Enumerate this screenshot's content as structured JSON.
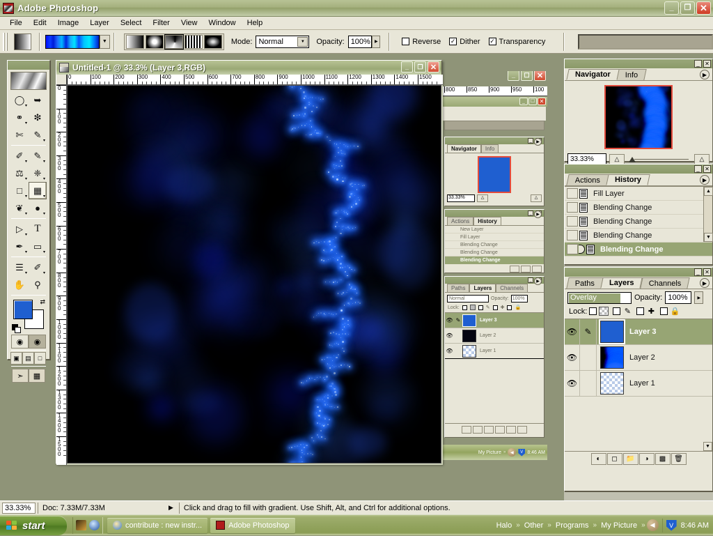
{
  "app": {
    "title": "Adobe Photoshop",
    "icon": "photoshop-icon",
    "window_buttons": {
      "minimize": "_",
      "maximize": "❐",
      "close": "✕"
    }
  },
  "menu": {
    "items": [
      "File",
      "Edit",
      "Image",
      "Layer",
      "Select",
      "Filter",
      "View",
      "Window",
      "Help"
    ]
  },
  "options_bar": {
    "tool": "gradient-tool",
    "gradient_preset": "blue-cyan-stripes",
    "gradient_types": [
      "linear-gradient",
      "radial-gradient",
      "angle-gradient",
      "reflected-gradient",
      "diamond-gradient"
    ],
    "gradient_type_selected_index": 2,
    "mode_label": "Mode:",
    "mode_value": "Normal",
    "opacity_label": "Opacity:",
    "opacity_value": "100%",
    "reverse_label": "Reverse",
    "reverse_checked": false,
    "dither_label": "Dither",
    "dither_checked": true,
    "transparency_label": "Transparency",
    "transparency_checked": true
  },
  "toolbox": {
    "tools": [
      {
        "name": "marquee-tool",
        "glyph": "◯"
      },
      {
        "name": "move-tool",
        "glyph": "✥"
      },
      {
        "name": "lasso-tool",
        "glyph": "☁"
      },
      {
        "name": "magic-wand-tool",
        "glyph": "✳"
      },
      {
        "name": "crop-tool",
        "glyph": "⛶"
      },
      {
        "name": "slice-tool",
        "glyph": "✐"
      },
      {
        "name": "healing-brush-tool",
        "glyph": "✎"
      },
      {
        "name": "brush-tool",
        "glyph": "✒"
      },
      {
        "name": "clone-stamp-tool",
        "glyph": "⚑"
      },
      {
        "name": "history-brush-tool",
        "glyph": "❄"
      },
      {
        "name": "eraser-tool",
        "glyph": "▱"
      },
      {
        "name": "gradient-tool",
        "glyph": "▨"
      },
      {
        "name": "blur-tool",
        "glyph": "❧"
      },
      {
        "name": "dodge-tool",
        "glyph": "⚫"
      },
      {
        "name": "path-selection-tool",
        "glyph": "↖"
      },
      {
        "name": "type-tool",
        "glyph": "T"
      },
      {
        "name": "pen-tool",
        "glyph": "✑"
      },
      {
        "name": "shape-tool",
        "glyph": "▭"
      },
      {
        "name": "notes-tool",
        "glyph": "◰"
      },
      {
        "name": "eyedropper-tool",
        "glyph": "⚗"
      },
      {
        "name": "hand-tool",
        "glyph": "✋"
      },
      {
        "name": "zoom-tool",
        "glyph": "⌕"
      }
    ],
    "selected_tool": "gradient-tool",
    "foreground_color": "#1f5fd0",
    "background_color": "#ffffff",
    "mask_modes": [
      "standard-mode",
      "quick-mask-mode"
    ],
    "screen_modes": [
      "standard-screen-mode",
      "full-screen-with-menubar",
      "full-screen-mode"
    ],
    "jump_to": [
      "jump-to-imageready",
      "jump-to-other"
    ]
  },
  "document": {
    "title": "Untitled-1 @ 33.3% (Layer 3,RGB)",
    "icon": "document-icon",
    "zoom": "33.3%",
    "ruler_h_labels": [
      "0",
      "100",
      "200",
      "300",
      "400",
      "500",
      "600",
      "700",
      "800",
      "900",
      "1000",
      "1100",
      "1200",
      "1300",
      "1400",
      "1500"
    ],
    "ruler_v_labels": [
      "0",
      "100",
      "200",
      "300",
      "400",
      "500",
      "600",
      "700",
      "800",
      "900",
      "1000",
      "1100",
      "1200",
      "1300",
      "1400",
      "1500"
    ],
    "window_buttons": {
      "minimize": "_",
      "maximize": "❐",
      "close": "✕"
    },
    "artwork": "blue-lightning-on-black"
  },
  "navigator": {
    "tabs": [
      {
        "label": "Navigator",
        "active": true
      },
      {
        "label": "Info",
        "active": false
      }
    ],
    "zoom_value": "33.33%",
    "thumbnail": "blue-lightning-thumbnail",
    "view_box_color": "#e34b3c"
  },
  "history": {
    "tabs": [
      {
        "label": "Actions",
        "active": false
      },
      {
        "label": "History",
        "active": true
      }
    ],
    "items": [
      {
        "label": "Fill Layer",
        "selected": false
      },
      {
        "label": "Blending Change",
        "selected": false
      },
      {
        "label": "Blending Change",
        "selected": false
      },
      {
        "label": "Blending Change",
        "selected": false
      },
      {
        "label": "Blending Change",
        "selected": true
      }
    ],
    "footer_buttons": [
      "create-document-from-state",
      "create-new-snapshot",
      "delete-state"
    ]
  },
  "layers": {
    "tabs": [
      {
        "label": "Paths",
        "active": false
      },
      {
        "label": "Layers",
        "active": true
      },
      {
        "label": "Channels",
        "active": false
      }
    ],
    "blend_mode": "Overlay",
    "opacity_label": "Opacity:",
    "opacity_value": "100%",
    "lock_label": "Lock:",
    "lock_options": [
      "lock-transparent-pixels",
      "lock-image-pixels",
      "lock-position",
      "lock-all"
    ],
    "rows": [
      {
        "name": "Layer 3",
        "selected": true,
        "thumb": "solid-blue",
        "visible": true,
        "brush": true
      },
      {
        "name": "Layer 2",
        "selected": false,
        "thumb": "lightning-black",
        "visible": true,
        "brush": false
      },
      {
        "name": "Layer 1",
        "selected": false,
        "thumb": "transparent",
        "visible": true,
        "brush": false
      }
    ],
    "footer_buttons": [
      "add-layer-style",
      "add-layer-mask",
      "create-new-group",
      "create-adjustment-layer",
      "create-new-layer",
      "delete-layer"
    ]
  },
  "nested_window": {
    "navigator": {
      "tabs": [
        {
          "label": "Navigator",
          "active": true
        },
        {
          "label": "Info",
          "active": false
        }
      ],
      "zoom_value": "33.33%",
      "thumbnail": "solid-blue"
    },
    "history": {
      "tabs": [
        {
          "label": "Actions",
          "active": false
        },
        {
          "label": "History",
          "active": true
        }
      ],
      "items": [
        {
          "label": "New Layer",
          "selected": false
        },
        {
          "label": "Fill Layer",
          "selected": false
        },
        {
          "label": "Blending Change",
          "selected": false
        },
        {
          "label": "Blending Change",
          "selected": false
        },
        {
          "label": "Blending Change",
          "selected": true
        }
      ]
    },
    "layers": {
      "tabs": [
        {
          "label": "Paths",
          "active": false
        },
        {
          "label": "Layers",
          "active": true
        },
        {
          "label": "Channels",
          "active": false
        }
      ],
      "blend_mode": "Normal",
      "opacity_label": "Opacity:",
      "opacity_value": "100%",
      "lock_label": "Lock:",
      "rows": [
        {
          "name": "Layer 3",
          "selected": true
        },
        {
          "name": "Layer 2",
          "selected": false
        },
        {
          "name": "Layer 1",
          "selected": false
        }
      ]
    },
    "ruler_labels": [
      "800",
      "850",
      "900",
      "950",
      "100"
    ],
    "taskbar_clock": "8:46 AM",
    "taskbar_items": [
      "My Picture"
    ]
  },
  "status_bar": {
    "zoom": "33.33%",
    "doc_info": "Doc: 7.33M/7.33M",
    "hint": "Click and drag to fill with gradient.  Use Shift, Alt, and Ctrl for additional options."
  },
  "taskbar": {
    "start_label": "start",
    "quick_launch": [
      "media-icon",
      "player-icon"
    ],
    "windows": [
      {
        "label": "contribute : new instr...",
        "icon": "internet-explorer-icon",
        "active": false
      },
      {
        "label": "Adobe Photoshop",
        "icon": "photoshop-icon",
        "active": true
      }
    ],
    "tray_links": [
      "Halo",
      "Other",
      "Programs",
      "My Picture"
    ],
    "tray_icons": [
      "show-hidden-icons",
      "antivirus-shield-icon"
    ],
    "clock": "8:46 AM"
  },
  "colors": {
    "titlebar_green": "#9aa76a",
    "panel_bg": "#e8e6d8",
    "selection_green": "#97a574",
    "accent_blue": "#1f5fd0",
    "close_red": "#cf3a22"
  }
}
